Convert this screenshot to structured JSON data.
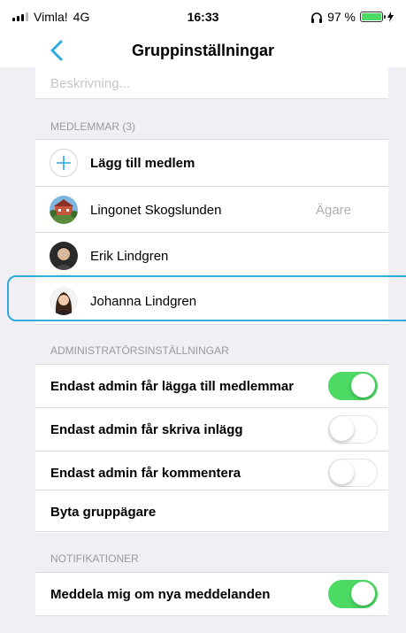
{
  "status_bar": {
    "carrier": "Vimla!",
    "network": "4G",
    "time": "16:33",
    "battery_percent_label": "97 %",
    "battery_fraction": 0.97
  },
  "nav": {
    "title": "Gruppinställningar",
    "back_icon": "chevron-left-icon"
  },
  "description": {
    "placeholder": "Beskrivning..."
  },
  "members": {
    "header": "MEDLEMMAR (3)",
    "add_label": "Lägg till medlem",
    "items": [
      {
        "name": "Lingonet Skogslunden",
        "role": "Ägare"
      },
      {
        "name": "Erik Lindgren",
        "role": ""
      },
      {
        "name": "Johanna Lindgren",
        "role": ""
      }
    ]
  },
  "admin": {
    "header": "ADMINISTRATÖRSINSTÄLLNINGAR",
    "settings": [
      {
        "label": "Endast admin får lägga till medlemmar",
        "enabled": true
      },
      {
        "label": "Endast admin får skriva inlägg",
        "enabled": false
      },
      {
        "label": "Endast admin får kommentera",
        "enabled": false
      }
    ],
    "change_owner_label": "Byta gruppägare"
  },
  "notifications": {
    "header": "NOTIFIKATIONER",
    "settings": [
      {
        "label": "Meddela mig om nya meddelanden",
        "enabled": true
      }
    ]
  },
  "colors": {
    "accent": "#2eaadc",
    "toggle_on": "#4cd964",
    "secondary_text": "#9a9aa0",
    "background": "#efeff4"
  }
}
